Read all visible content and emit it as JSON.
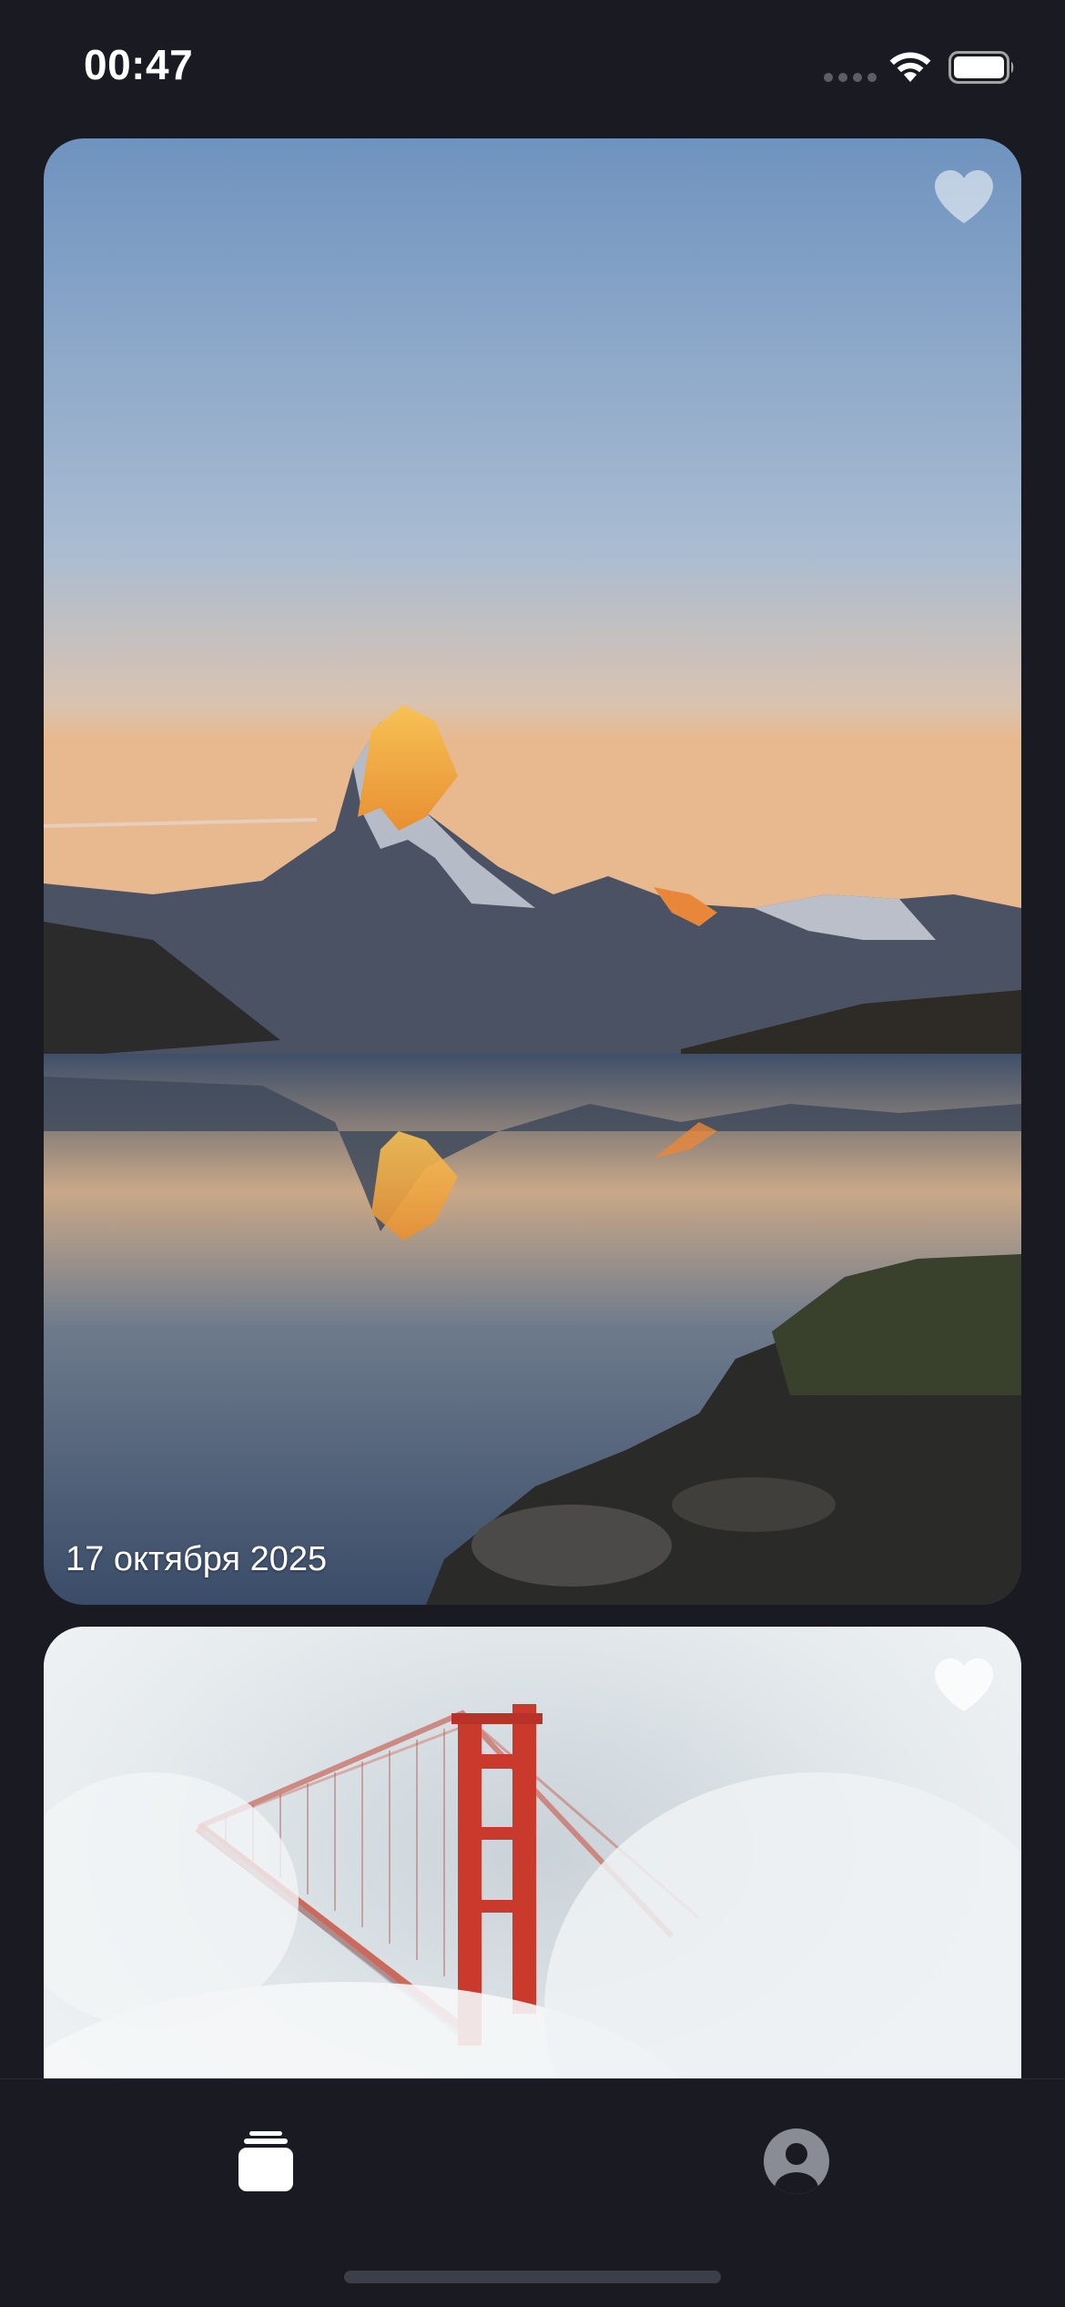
{
  "status_bar": {
    "time": "00:47"
  },
  "feed": {
    "cards": [
      {
        "image": "mountain-lake-reflection",
        "date": "17 октября 2025",
        "liked": false
      },
      {
        "image": "golden-gate-bridge-fog",
        "liked": false
      }
    ]
  },
  "tab_bar": {
    "tabs": [
      {
        "icon": "stack-icon",
        "active": true
      },
      {
        "icon": "profile-icon",
        "active": false
      }
    ]
  },
  "colors": {
    "background": "#1a1b22",
    "tab_active": "#ffffff",
    "tab_inactive": "#8a8c95",
    "like_inactive": "#ffffff"
  }
}
